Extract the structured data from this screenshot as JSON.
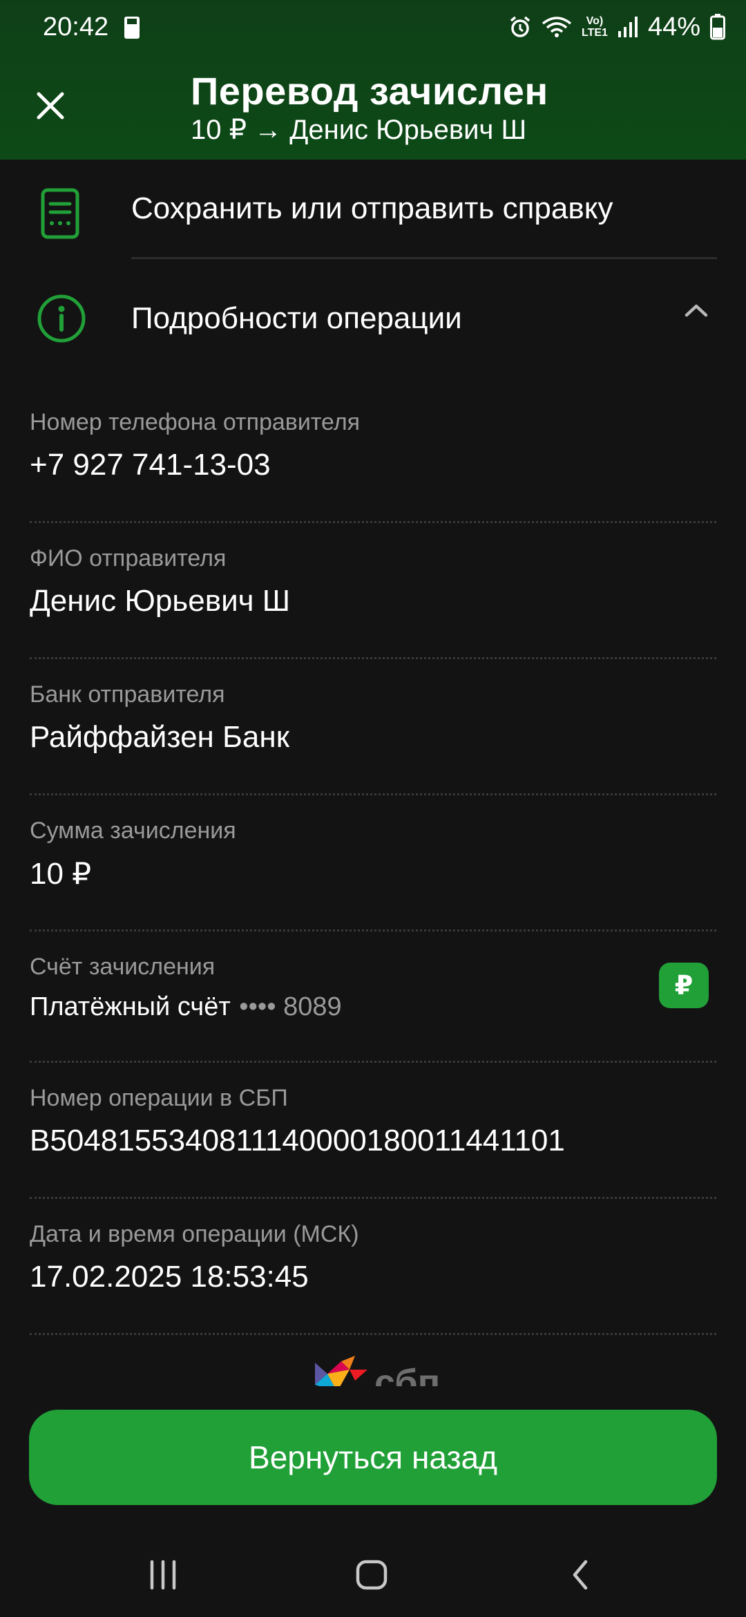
{
  "status_bar": {
    "time": "20:42",
    "battery_percent": "44%",
    "network_label_top": "Vo)",
    "network_label_bottom": "LTE1"
  },
  "header": {
    "title": "Перевод зачислен",
    "subtitle": "10 ₽ → Денис Юрьевич Ш"
  },
  "actions": {
    "certificate_label": "Сохранить или отправить справку",
    "details_label": "Подробности операции"
  },
  "fields": [
    {
      "label": "Номер телефона отправителя",
      "value": "+7 927 741-13-03"
    },
    {
      "label": "ФИО отправителя",
      "value": "Денис Юрьевич Ш"
    },
    {
      "label": "Банк отправителя",
      "value": "Райффайзен Банк"
    },
    {
      "label": "Сумма зачисления",
      "value": "10 ₽"
    },
    {
      "label": "Счёт зачисления",
      "value": "Платёжный счёт",
      "mask": "•••• 8089",
      "badge": "₽"
    },
    {
      "label": "Номер операции в СБП",
      "value": "B5048155340811140000180011441101"
    },
    {
      "label": "Дата и время операции (МСК)",
      "value": "17.02.2025 18:53:45"
    }
  ],
  "sbp_logo_text": "сбп",
  "back_button_label": "Вернуться назад",
  "colors": {
    "header_bg": "#0d4a17",
    "accent_green": "#21a038",
    "icon_green": "#21a038",
    "background": "#131313"
  },
  "icons": {
    "close": "close-icon",
    "certificate": "document-icon",
    "details": "info-icon",
    "collapse": "chevron-up-icon",
    "account": "ruble-icon"
  }
}
